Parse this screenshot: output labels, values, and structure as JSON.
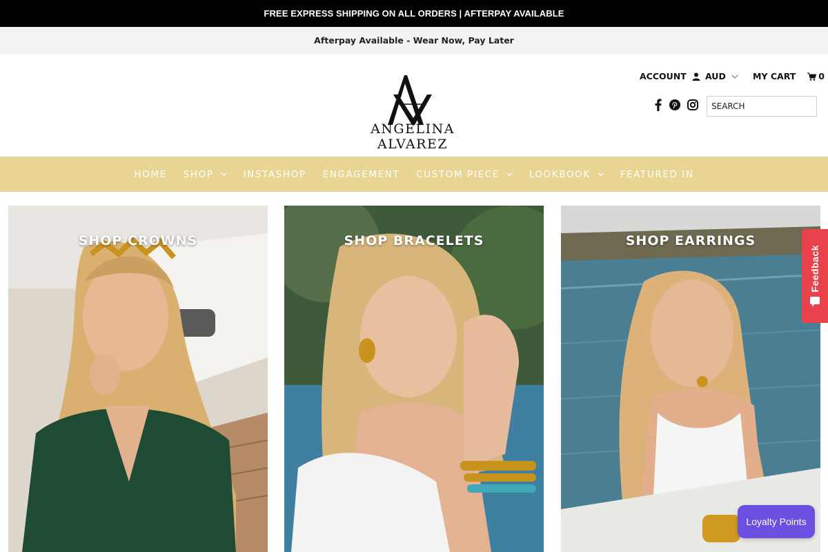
{
  "announcement": {
    "text": "FREE EXPRESS SHIPPING ON ALL ORDERS | AFTERPAY AVAILABLE"
  },
  "afterpay_bar": {
    "text": "Afterpay Available - Wear Now, Pay Later"
  },
  "header": {
    "logo_text": "ANGELINA ALVAREZ",
    "account_label": "ACCOUNT",
    "currency": "AUD",
    "cart_label": "MY CART",
    "cart_count": "0",
    "search_placeholder": "SEARCH",
    "social_icons": [
      "facebook-icon",
      "pinterest-icon",
      "instagram-icon"
    ]
  },
  "nav": {
    "items": [
      {
        "label": "HOME",
        "has_dropdown": false
      },
      {
        "label": "SHOP",
        "has_dropdown": true
      },
      {
        "label": "INSTASHOP",
        "has_dropdown": false
      },
      {
        "label": "ENGAGEMENT",
        "has_dropdown": false
      },
      {
        "label": "CUSTOM PIECE",
        "has_dropdown": true
      },
      {
        "label": "LOOKBOOK",
        "has_dropdown": true
      },
      {
        "label": "FEATURED IN",
        "has_dropdown": false
      }
    ],
    "background": "#e8d594"
  },
  "tiles": [
    {
      "label": "SHOP CROWNS"
    },
    {
      "label": "SHOP BRACELETS"
    },
    {
      "label": "SHOP EARRINGS"
    }
  ],
  "feedback_tab": {
    "label": "Feedback",
    "color": "#e8424d"
  },
  "loyalty_button": {
    "label": "Loyalty Points",
    "color": "#6b4fe0"
  }
}
